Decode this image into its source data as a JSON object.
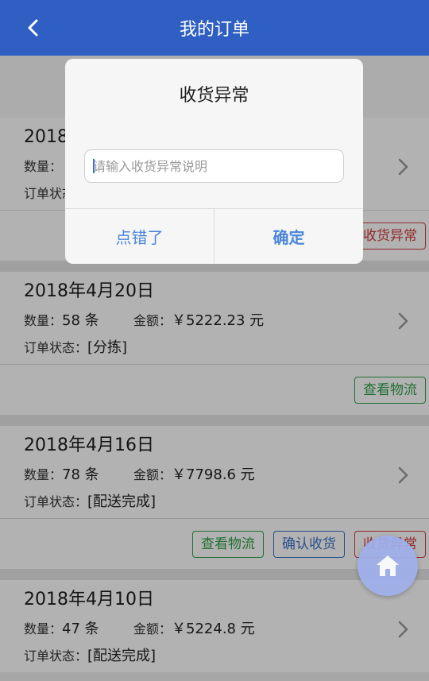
{
  "header": {
    "title": "我的订单"
  },
  "labels": {
    "qty": "数量：",
    "amount": "金额：",
    "status": "订单状态："
  },
  "orders": [
    {
      "date": "2018",
      "qty": "",
      "amount": "",
      "status": "",
      "actions": [
        "收货异常"
      ]
    },
    {
      "date": "2018年4月20日",
      "qty": "58 条",
      "amount": "￥5222.23 元",
      "status": "[分拣]",
      "actions": [
        "查看物流"
      ]
    },
    {
      "date": "2018年4月16日",
      "qty": "78 条",
      "amount": "￥7798.6 元",
      "status": "[配送完成]",
      "actions": [
        "查看物流",
        "确认收货",
        "收货异常"
      ]
    },
    {
      "date": "2018年4月10日",
      "qty": "47 条",
      "amount": "￥5224.8 元",
      "status": "[配送完成]",
      "actions": []
    }
  ],
  "dialog": {
    "title": "收货异常",
    "input_placeholder": "请输入收货异常说明",
    "cancel_label": "点错了",
    "confirm_label": "确定"
  },
  "colors": {
    "header": "#2f5fc2",
    "green_button": "#2f9f47",
    "blue_button": "#3a6fc9",
    "red_button": "#d33b3b",
    "dialog_button": "#4a86d8",
    "fab": "#9fb0ec"
  },
  "icons": {
    "back": "chevron-left-icon",
    "row_arrow": "chevron-right-icon",
    "home": "home-icon"
  }
}
